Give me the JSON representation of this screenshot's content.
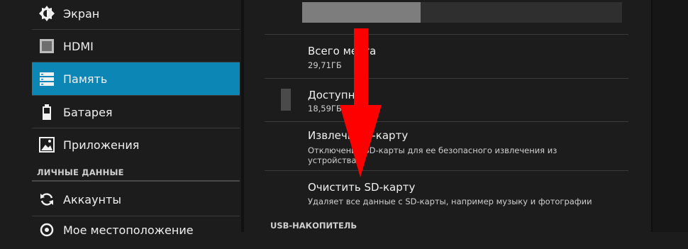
{
  "sidebar": {
    "items": [
      {
        "label": "Экран",
        "icon": "brightness-icon",
        "active": false
      },
      {
        "label": "HDMI",
        "icon": "hdmi-icon",
        "active": false
      },
      {
        "label": "Память",
        "icon": "storage-icon",
        "active": true
      },
      {
        "label": "Батарея",
        "icon": "battery-icon",
        "active": false
      },
      {
        "label": "Приложения",
        "icon": "apps-icon",
        "active": false
      }
    ],
    "personal_header": "ЛИЧНЫЕ ДАННЫЕ",
    "personal_items": [
      {
        "label": "Аккаунты",
        "icon": "sync-icon"
      },
      {
        "label": "Мое местоположение",
        "icon": "location-icon"
      }
    ]
  },
  "storage": {
    "used_fraction": 0.37,
    "total": {
      "title": "Всего места",
      "value": "29,71ГБ"
    },
    "available": {
      "title": "Доступно",
      "value": "18,59ГБ"
    },
    "unmount": {
      "title": "Извлечь SD-карту",
      "line1": "Отключение SD-карты для ее безопасного извлечения из",
      "line2": "устройства"
    },
    "erase": {
      "title": "Очистить SD-карту",
      "description": "Удаляет все данные с SD-карты, например музыку и фотографии"
    },
    "usb_header": "USB-НАКОПИТЕЛЬ"
  },
  "colors": {
    "accent": "#0c86b5",
    "background": "#1c1c1c",
    "arrow": "#ff0000"
  }
}
